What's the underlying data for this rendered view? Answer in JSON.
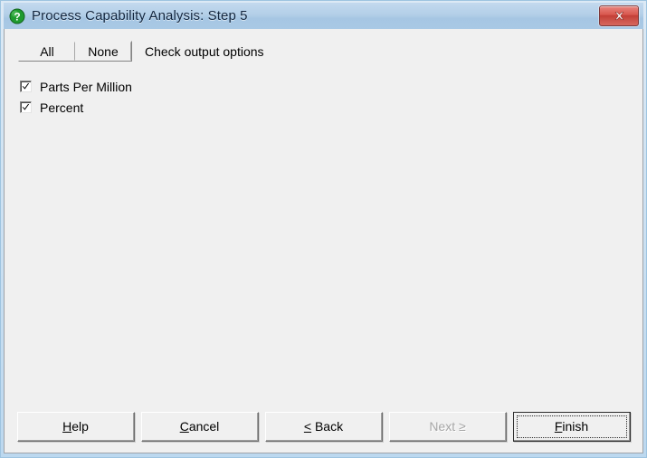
{
  "window": {
    "title": "Process Capability Analysis: Step 5",
    "icon": "question-mark-icon",
    "close_label": "✕",
    "frame_color": "#bcd8ef",
    "titlebar_color": "#a9c9e5",
    "client_color": "#f0f0f0",
    "close_button_color": "#c33f36",
    "icon_color": "#1f9b2f"
  },
  "toolbar": {
    "all_label": "All",
    "none_label": "None",
    "caption": "Check output options"
  },
  "options": [
    {
      "label": "Parts Per Million",
      "checked": true
    },
    {
      "label": "Percent",
      "checked": true
    }
  ],
  "buttons": [
    {
      "label": "Help",
      "accel": "H",
      "before": "",
      "after": "elp",
      "state": "normal"
    },
    {
      "label": "Cancel",
      "accel": "C",
      "before": "",
      "after": "ancel",
      "state": "normal"
    },
    {
      "label": "< Back",
      "accel": "<",
      "before": "",
      "after": " Back",
      "state": "normal"
    },
    {
      "label": "Next >",
      "accel": "",
      "before": "Next ≥",
      "after": "",
      "state": "disabled"
    },
    {
      "label": "Finish",
      "accel": "F",
      "before": "",
      "after": "inish",
      "state": "default"
    }
  ]
}
